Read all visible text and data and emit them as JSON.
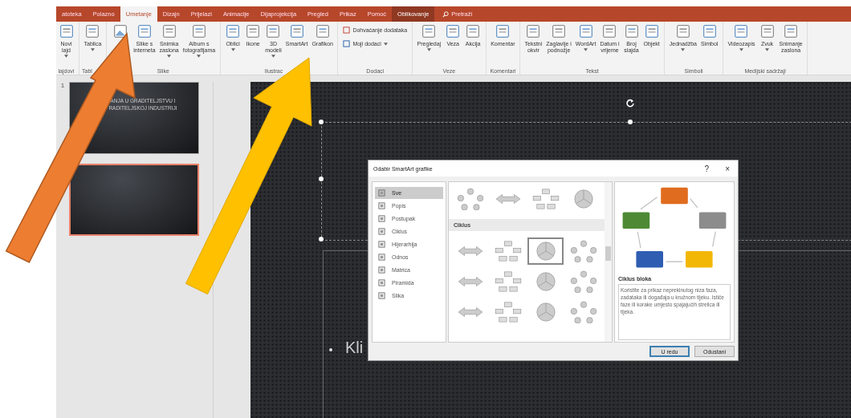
{
  "tabs": [
    {
      "label": "atoteka",
      "selected": false,
      "kind": "tab"
    },
    {
      "label": "Polazno",
      "selected": false,
      "kind": "tab"
    },
    {
      "label": "Umetanje",
      "selected": true,
      "kind": "tab"
    },
    {
      "label": "Dizajn",
      "selected": false,
      "kind": "tab"
    },
    {
      "label": "Prijelazi",
      "selected": false,
      "kind": "tab"
    },
    {
      "label": "Animacije",
      "selected": false,
      "kind": "tab"
    },
    {
      "label": "Dijaprojekcija",
      "selected": false,
      "kind": "tab"
    },
    {
      "label": "Pregled",
      "selected": false,
      "kind": "tab"
    },
    {
      "label": "Prikaz",
      "selected": false,
      "kind": "tab"
    },
    {
      "label": "Pomoć",
      "selected": false,
      "kind": "tab"
    },
    {
      "label": "Oblikovanje",
      "selected": false,
      "kind": "contextual"
    },
    {
      "label": "Pretraži",
      "selected": false,
      "kind": "search"
    }
  ],
  "ribbon": {
    "groups": [
      {
        "label": "lajdovi",
        "items": [
          {
            "kind": "large",
            "lines": [
              "Novi",
              "lajd"
            ],
            "dropdown": true
          }
        ]
      },
      {
        "label": "Tabl",
        "items": [
          {
            "kind": "large",
            "lines": [
              "Tablica"
            ],
            "dropdown": true
          }
        ]
      },
      {
        "label": "Slike",
        "items": [
          {
            "kind": "icon"
          },
          {
            "kind": "large",
            "lines": [
              "Slike s",
              "interneta"
            ],
            "dropdown": false
          },
          {
            "kind": "large",
            "lines": [
              "Snimka",
              "zaslona"
            ],
            "dropdown": true
          },
          {
            "kind": "large",
            "lines": [
              "Album s",
              "fotografijama"
            ],
            "dropdown": true
          }
        ]
      },
      {
        "label": "Ilustrac",
        "items": [
          {
            "kind": "large",
            "lines": [
              "Oblici"
            ],
            "dropdown": true
          },
          {
            "kind": "large",
            "lines": [
              "Ikone"
            ],
            "dropdown": false
          },
          {
            "kind": "large",
            "lines": [
              "3D",
              "modeli"
            ],
            "dropdown": true
          },
          {
            "kind": "large",
            "lines": [
              "SmartArt"
            ],
            "dropdown": false
          },
          {
            "kind": "large",
            "lines": [
              "Grafikon"
            ],
            "dropdown": false
          }
        ]
      },
      {
        "label": "Dodaci",
        "items": [
          {
            "kind": "row",
            "lines": [
              "Dohvaćanje dodataka"
            ],
            "dropdown": false
          },
          {
            "kind": "row",
            "lines": [
              "Moji dodaci"
            ],
            "dropdown": true
          }
        ]
      },
      {
        "label": "Veze",
        "items": [
          {
            "kind": "large",
            "lines": [
              "Pregledaj"
            ],
            "dropdown": true
          },
          {
            "kind": "large",
            "lines": [
              "Veza"
            ],
            "dropdown": false
          },
          {
            "kind": "large",
            "lines": [
              "Akcija"
            ],
            "dropdown": false
          }
        ]
      },
      {
        "label": "Komentari",
        "items": [
          {
            "kind": "large",
            "lines": [
              "Komentar"
            ],
            "dropdown": false
          }
        ]
      },
      {
        "label": "Tekst",
        "items": [
          {
            "kind": "large",
            "lines": [
              "Tekstni",
              "okvir"
            ],
            "dropdown": false
          },
          {
            "kind": "large",
            "lines": [
              "Zaglavlje i",
              "podnožje"
            ],
            "dropdown": false
          },
          {
            "kind": "large",
            "lines": [
              "WordArt"
            ],
            "dropdown": true
          },
          {
            "kind": "large",
            "lines": [
              "Datum i",
              "vrijeme"
            ],
            "dropdown": false
          },
          {
            "kind": "large",
            "lines": [
              "Broj",
              "slajda"
            ],
            "dropdown": false
          },
          {
            "kind": "large",
            "lines": [
              "Objekt"
            ],
            "dropdown": false
          }
        ]
      },
      {
        "label": "Simboli",
        "items": [
          {
            "kind": "large",
            "lines": [
              "Jednadžba"
            ],
            "dropdown": true
          },
          {
            "kind": "large",
            "lines": [
              "Simbol"
            ],
            "dropdown": false
          }
        ]
      },
      {
        "label": "Medijski sadržaji",
        "items": [
          {
            "kind": "large",
            "lines": [
              "Videozapis"
            ],
            "dropdown": true
          },
          {
            "kind": "large",
            "lines": [
              "Zvuk"
            ],
            "dropdown": true
          },
          {
            "kind": "large",
            "lines": [
              "Snimanje",
              "zaslona"
            ],
            "dropdown": false
          }
        ]
      }
    ]
  },
  "slides": [
    {
      "number": "1",
      "selected": false,
      "title_lines": [
        "ANJA U GRADITELJSTVU I",
        "RADITELJSKOJ INDUSTRIJI"
      ]
    },
    {
      "selected": true
    }
  ],
  "slide": {
    "bullet_text": "Kli"
  },
  "dialog": {
    "title": "Odabir SmartArt grafike",
    "help": "?",
    "close": "×",
    "categories": [
      {
        "label": "Sve",
        "selected": true
      },
      {
        "label": "Popis",
        "selected": false
      },
      {
        "label": "Postupak",
        "selected": false
      },
      {
        "label": "Ciklus",
        "selected": false
      },
      {
        "label": "Hijerarhija",
        "selected": false
      },
      {
        "label": "Odnos",
        "selected": false
      },
      {
        "label": "Matrica",
        "selected": false
      },
      {
        "label": "Piramida",
        "selected": false
      },
      {
        "label": "Slika",
        "selected": false
      }
    ],
    "sections": [
      {
        "items": [
          {
            "selected": false
          },
          {
            "selected": false
          },
          {
            "selected": false
          },
          {
            "selected": false
          }
        ]
      },
      {
        "heading": "Ciklus",
        "items": [
          {
            "selected": false
          },
          {
            "selected": false
          },
          {
            "selected": true
          },
          {
            "selected": false
          },
          {
            "selected": false
          },
          {
            "selected": false
          },
          {
            "selected": false
          },
          {
            "selected": false
          },
          {
            "selected": false
          },
          {
            "selected": false
          },
          {
            "selected": false
          },
          {
            "selected": false
          }
        ]
      }
    ],
    "preview": {
      "name": "Ciklus bloka",
      "description": "Koristite za prikaz neprekinutog niza faza, zadataka ili događaja u kružnom tijeku. Ističe faze ili korake umjesto spajajućih strelica ili tijeka."
    },
    "buttons": [
      {
        "label": "U redu",
        "default": true
      },
      {
        "label": "Odustani",
        "default": false
      }
    ]
  }
}
